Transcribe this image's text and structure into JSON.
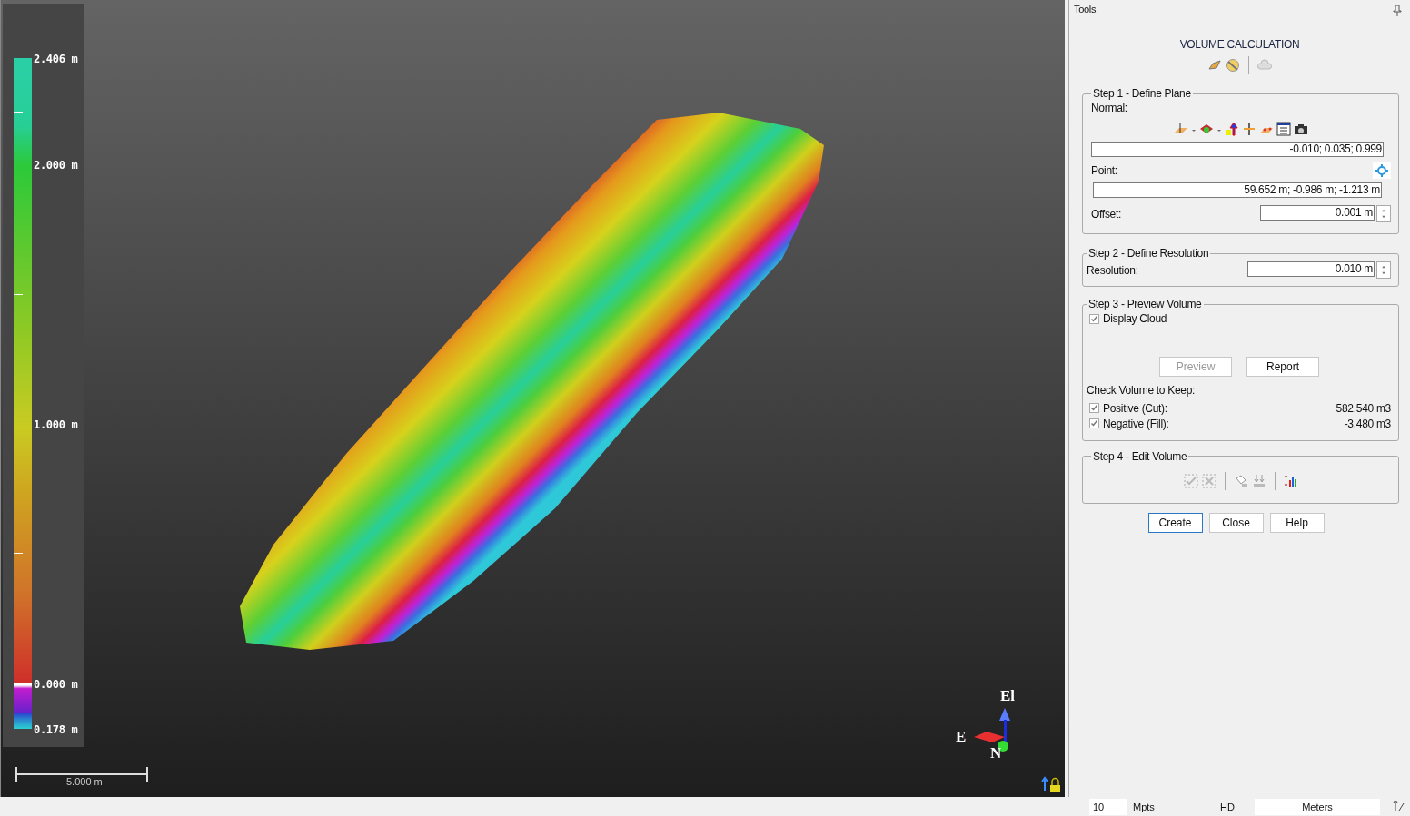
{
  "viewport": {
    "legend": {
      "labels": [
        "2.406 m",
        "2.000 m",
        "1.000 m",
        "0.000 m",
        "0.178 m"
      ]
    },
    "scale_bar": {
      "label": "5.000 m"
    },
    "axes": {
      "up": "El",
      "east": "E",
      "north": "N"
    }
  },
  "panel": {
    "title": "Tools",
    "heading": "VOLUME CALCULATION",
    "step1": {
      "title": "Step 1 - Define Plane",
      "normal_label": "Normal:",
      "normal_value": "-0.010; 0.035; 0.999",
      "point_label": "Point:",
      "point_value": "59.652 m; -0.986 m; -1.213 m",
      "offset_label": "Offset:",
      "offset_value": "0.001 m"
    },
    "step2": {
      "title": "Step 2 - Define Resolution",
      "resolution_label": "Resolution:",
      "resolution_value": "0.010 m"
    },
    "step3": {
      "title": "Step 3 - Preview Volume",
      "display_cloud": {
        "label": "Display Cloud",
        "checked": true
      },
      "buttons": [
        {
          "label": "Preview",
          "disabled": true
        },
        {
          "label": "Report",
          "disabled": false
        }
      ],
      "keep_label": "Check Volume to Keep:",
      "volumes": [
        {
          "label": "Positive (Cut):",
          "checked": true,
          "value": "582.540 m3"
        },
        {
          "label": "Negative (Fill):",
          "checked": true,
          "value": "-3.480 m3"
        }
      ]
    },
    "step4": {
      "title": "Step 4 - Edit Volume"
    },
    "buttons": [
      {
        "label": "Create",
        "selected": true
      },
      {
        "label": "Close",
        "selected": false
      },
      {
        "label": "Help",
        "selected": false
      }
    ]
  },
  "status_bar": {
    "point_count": "10",
    "point_unit": "Mpts",
    "quality": "HD",
    "units": "Meters"
  }
}
